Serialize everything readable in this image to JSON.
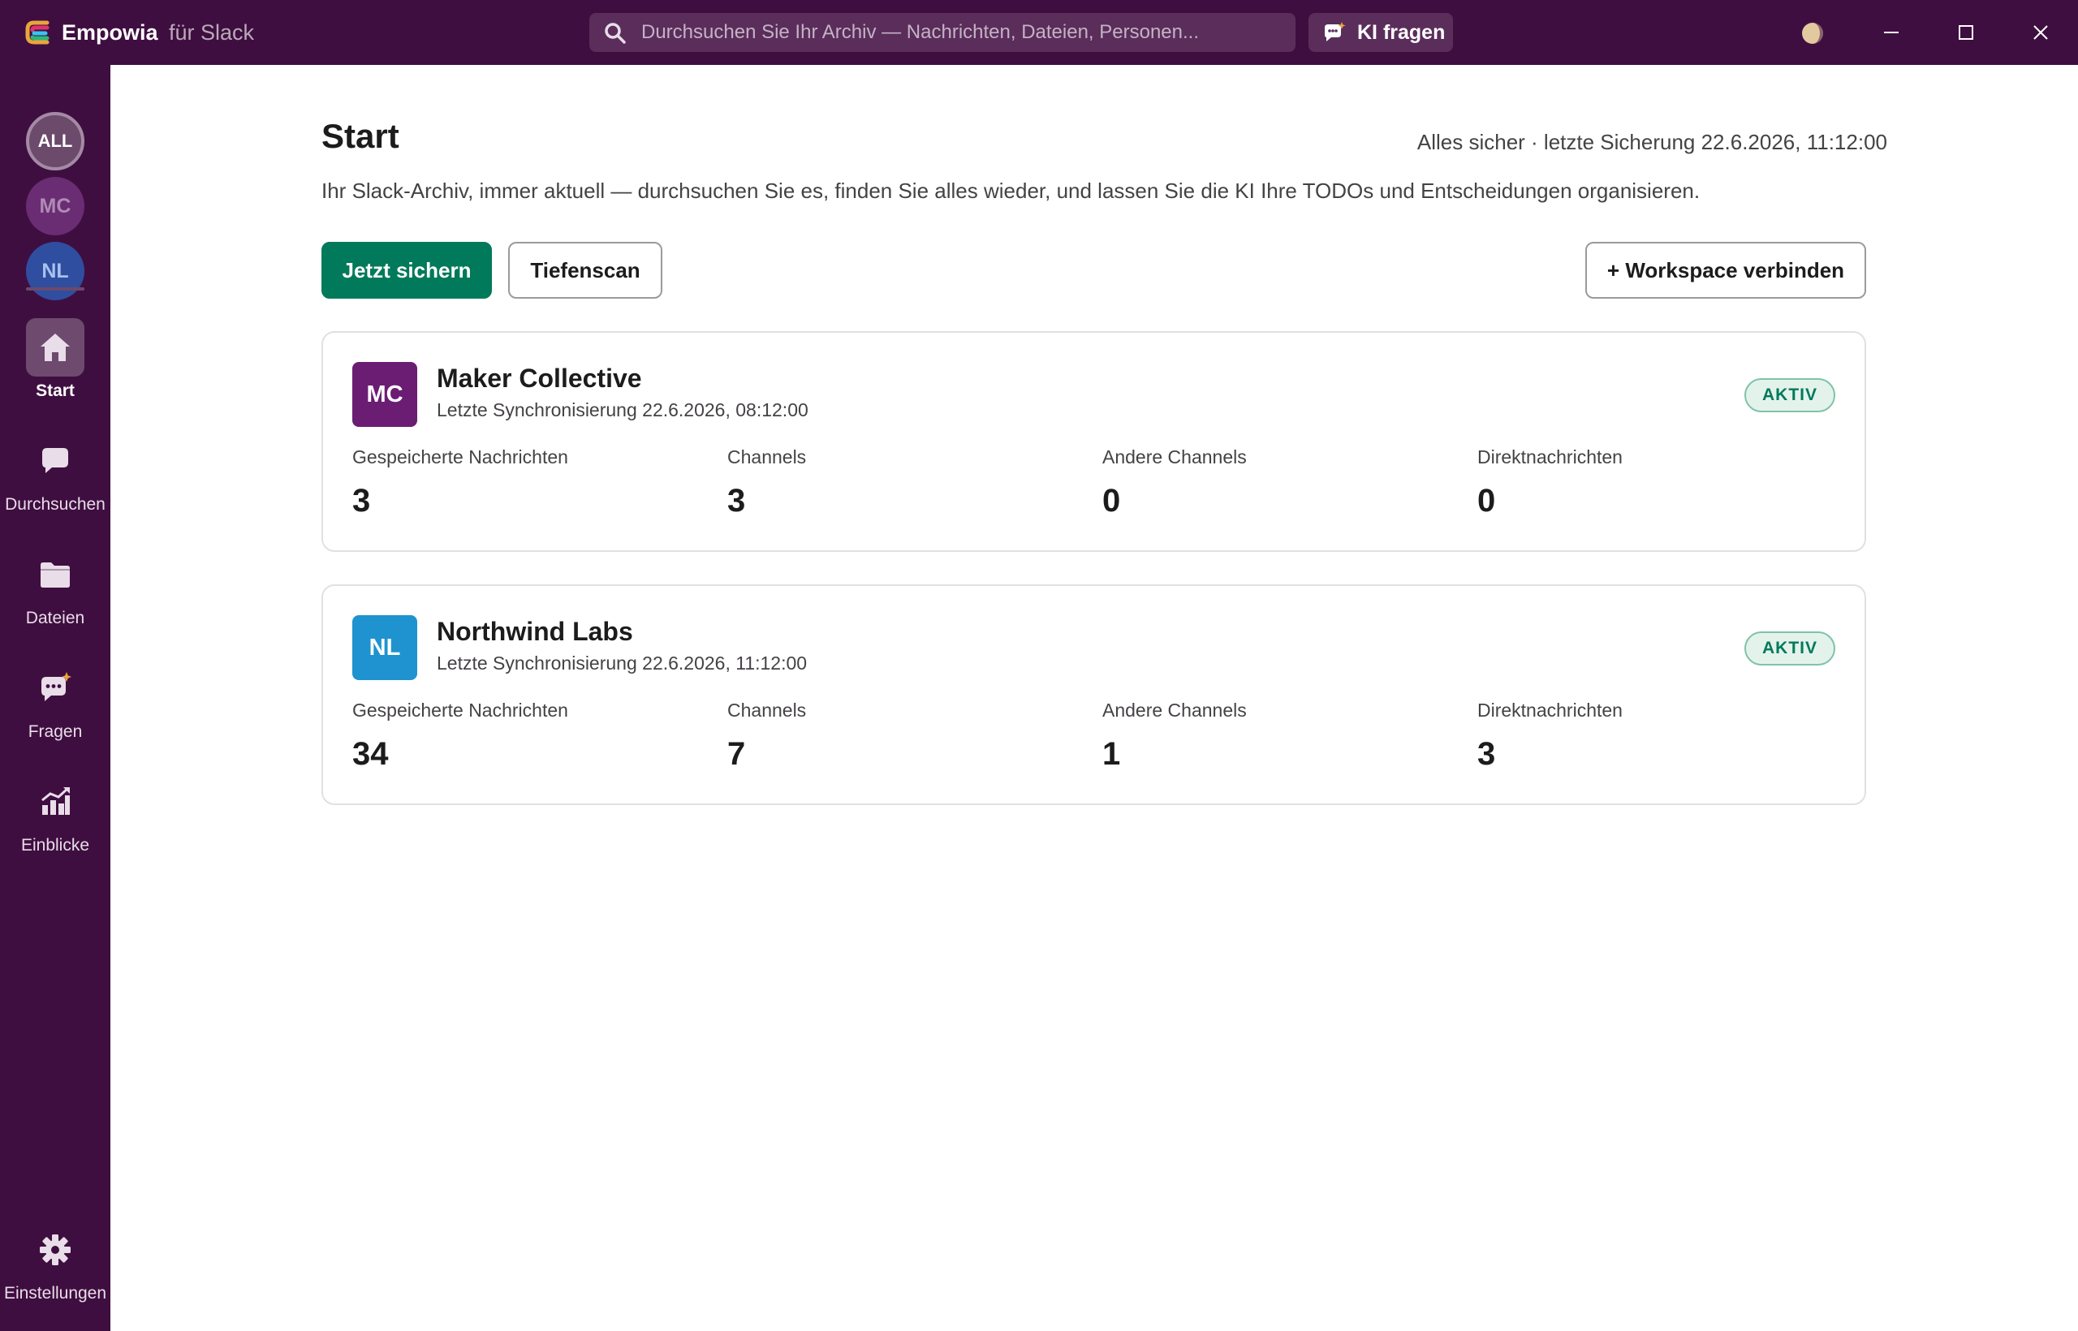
{
  "app": {
    "name": "Empowia",
    "subtitle": "für Slack",
    "search_placeholder": "Durchsuchen Sie Ihr Archiv — Nachrichten, Dateien, Personen...",
    "ki_button": "KI fragen"
  },
  "sidebar": {
    "workspaces": [
      "ALL",
      "MC",
      "NL"
    ],
    "nav": [
      {
        "label": "Start",
        "icon": "home-icon",
        "active": true
      },
      {
        "label": "Durchsuchen",
        "icon": "chat-bubble-icon",
        "active": false
      },
      {
        "label": "Dateien",
        "icon": "folder-icon",
        "active": false
      },
      {
        "label": "Fragen",
        "icon": "ai-chat-icon",
        "active": false
      },
      {
        "label": "Einblicke",
        "icon": "chart-icon",
        "active": false
      }
    ],
    "settings_label": "Einstellungen"
  },
  "main": {
    "title": "Start",
    "backup_status": "Alles sicher · letzte Sicherung 22.6.2026, 11:12:00",
    "description": "Ihr Slack-Archiv, immer aktuell — durchsuchen Sie es, finden Sie alles wieder, und lassen Sie die KI Ihre TODOs und Entscheidungen organisieren.",
    "buttons": {
      "backup_now": "Jetzt sichern",
      "deep_scan": "Tiefenscan",
      "connect_workspace": "+ Workspace verbinden"
    },
    "workspaces": [
      {
        "initials": "MC",
        "name": "Maker Collective",
        "last_sync": "Letzte Synchronisierung 22.6.2026, 08:12:00",
        "status": "AKTIV",
        "stats": [
          {
            "label": "Gespeicherte Nachrichten",
            "value": "3"
          },
          {
            "label": "Channels",
            "value": "3"
          },
          {
            "label": "Andere Channels",
            "value": "0"
          },
          {
            "label": "Direktnachrichten",
            "value": "0"
          }
        ]
      },
      {
        "initials": "NL",
        "name": "Northwind Labs",
        "last_sync": "Letzte Synchronisierung 22.6.2026, 11:12:00",
        "status": "AKTIV",
        "stats": [
          {
            "label": "Gespeicherte Nachrichten",
            "value": "34"
          },
          {
            "label": "Channels",
            "value": "7"
          },
          {
            "label": "Andere Channels",
            "value": "1"
          },
          {
            "label": "Direktnachrichten",
            "value": "3"
          }
        ]
      }
    ]
  },
  "colors": {
    "chrome": "#3f0e40",
    "primary": "#007a5a",
    "mc_avatar": "#6a1d73",
    "nl_avatar": "#1f93cf"
  }
}
